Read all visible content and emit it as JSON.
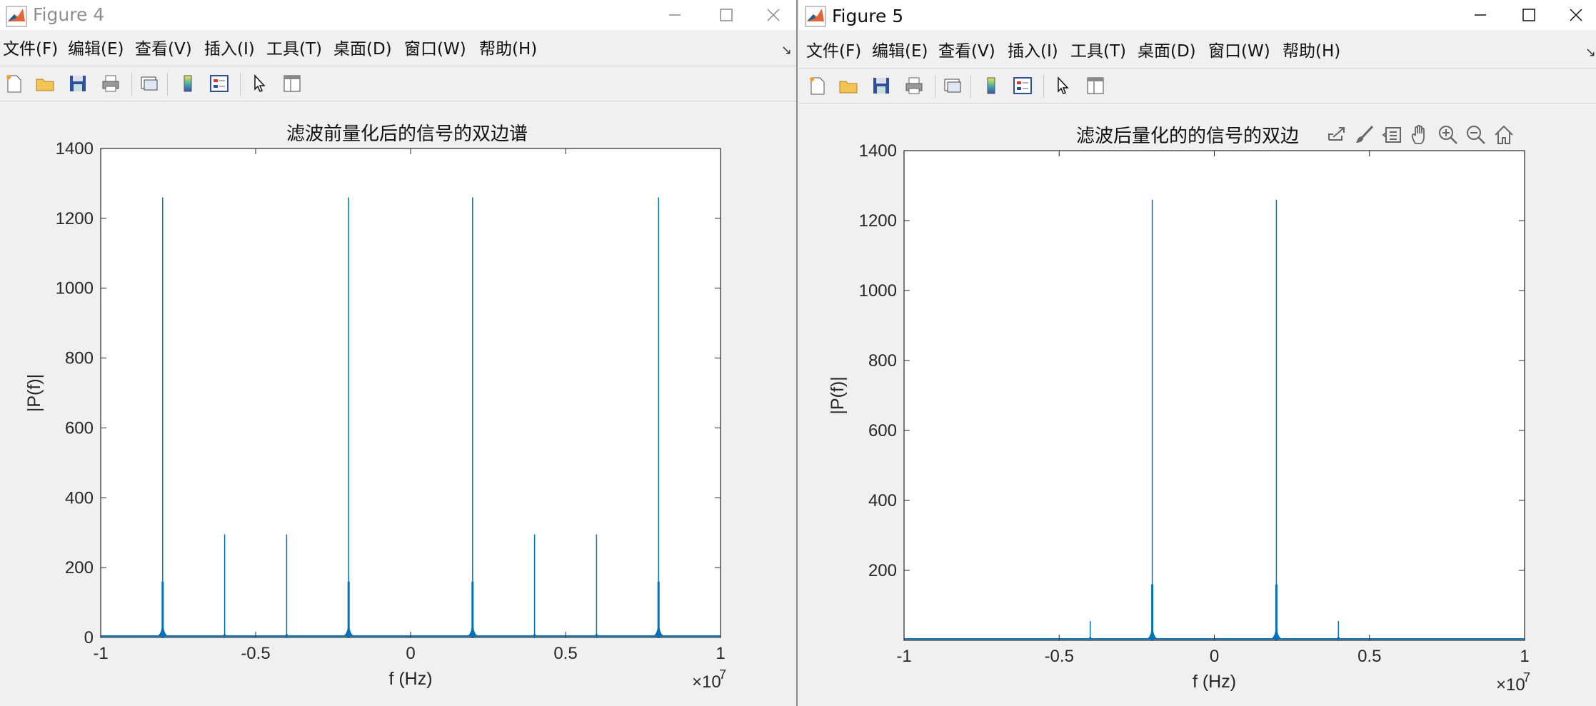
{
  "windows": [
    {
      "id": "fig4",
      "title": "Figure 4",
      "active": false,
      "menu": [
        "文件(F)",
        "编辑(E)",
        "查看(V)",
        "插入(I)",
        "工具(T)",
        "桌面(D)",
        "窗口(W)",
        "帮助(H)"
      ],
      "chart_data": {
        "type": "line",
        "title": "滤波前量化后的信号的双边谱",
        "xlabel": "f (Hz)",
        "ylabel": "|P(f)|",
        "x_exponent_label": "×10",
        "x_exponent": "7",
        "xlim": [
          -1,
          1
        ],
        "ylim": [
          0,
          1400
        ],
        "xticks": [
          -1,
          -0.5,
          0,
          0.5,
          1
        ],
        "xticklabels": [
          "-1",
          "-0.5",
          "0",
          "0.5",
          "1"
        ],
        "yticks": [
          0,
          200,
          400,
          600,
          800,
          1000,
          1200,
          1400
        ],
        "yticklabels": [
          "0",
          "200",
          "400",
          "600",
          "800",
          "1000",
          "1200",
          "1400"
        ],
        "color": "#0072bd",
        "peaks": [
          {
            "x": -0.8,
            "y": 1260
          },
          {
            "x": -0.6,
            "y": 295
          },
          {
            "x": -0.4,
            "y": 295
          },
          {
            "x": -0.2,
            "y": 1260
          },
          {
            "x": 0.2,
            "y": 1260
          },
          {
            "x": 0.4,
            "y": 295
          },
          {
            "x": 0.6,
            "y": 295
          },
          {
            "x": 0.8,
            "y": 1260
          }
        ]
      }
    },
    {
      "id": "fig5",
      "title": "Figure 5",
      "active": true,
      "menu": [
        "文件(F)",
        "编辑(E)",
        "查看(V)",
        "插入(I)",
        "工具(T)",
        "桌面(D)",
        "窗口(W)",
        "帮助(H)"
      ],
      "chart_data": {
        "type": "line",
        "title": "滤波后量化的的信号的双边",
        "xlabel": "f (Hz)",
        "ylabel": "|P(f)|",
        "x_exponent_label": "×10",
        "x_exponent": "7",
        "xlim": [
          -1,
          1
        ],
        "ylim": [
          0,
          1400
        ],
        "xticks": [
          -1,
          -0.5,
          0,
          0.5,
          1
        ],
        "xticklabels": [
          "-1",
          "-0.5",
          "0",
          "0.5",
          "1"
        ],
        "yticks": [
          200,
          400,
          600,
          800,
          1000,
          1200,
          1400
        ],
        "yticklabels": [
          "200",
          "400",
          "600",
          "800",
          "1000",
          "1200",
          "1400"
        ],
        "color": "#0072bd",
        "peaks": [
          {
            "x": -0.4,
            "y": 55
          },
          {
            "x": -0.2,
            "y": 1260
          },
          {
            "x": 0.2,
            "y": 1260
          },
          {
            "x": 0.4,
            "y": 55
          }
        ]
      }
    }
  ]
}
